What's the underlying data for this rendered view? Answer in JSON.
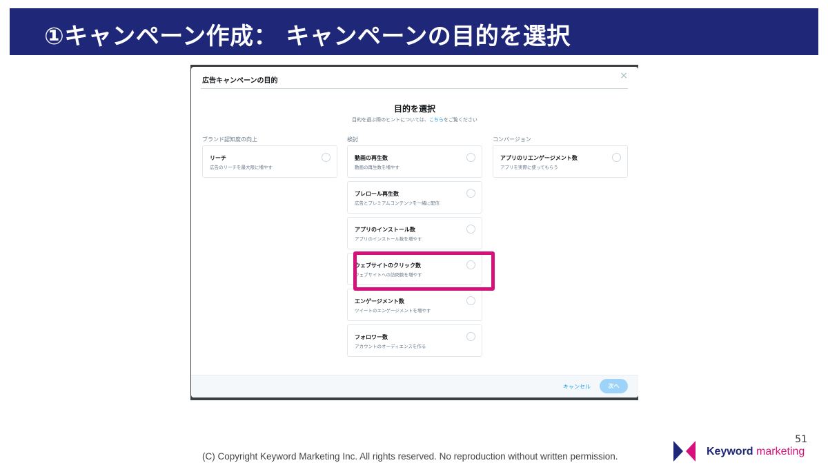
{
  "slide": {
    "title": "①キャンペーン作成： キャンペーンの目的を選択",
    "page_number": "51",
    "copyright": "(C) Copyright Keyword Marketing Inc. All rights reserved. No reproduction without written permission.",
    "logo": {
      "word1": "Keyword",
      "word2": "marketing"
    },
    "colors": {
      "banner": "#1f2878",
      "highlight": "#d6117b",
      "link": "#1da1f2"
    }
  },
  "dialog": {
    "title": "広告キャンペーンの目的",
    "close_icon": "close-icon",
    "heading": "目的を選択",
    "hint_prefix": "目的を選ぶ際のヒントについては、",
    "hint_link": "こちら",
    "hint_suffix": "をご覧ください",
    "columns": [
      {
        "label": "ブランド認知度の向上",
        "cards": [
          {
            "title": "リーチ",
            "desc": "広告のリーチを最大限に増やす"
          }
        ]
      },
      {
        "label": "検討",
        "cards": [
          {
            "title": "動画の再生数",
            "desc": "動画の再生数を増やす"
          },
          {
            "title": "プレロール再生数",
            "desc": "広告とプレミアムコンテンツを一緒に配信"
          },
          {
            "title": "アプリのインストール数",
            "desc": "アプリのインストール数を増やす"
          },
          {
            "title": "ウェブサイトのクリック数",
            "desc": "ウェブサイトへの訪問数を増やす"
          },
          {
            "title": "エンゲージメント数",
            "desc": "ツイートのエンゲージメントを増やす"
          },
          {
            "title": "フォロワー数",
            "desc": "アカウントのオーディエンスを作る"
          }
        ]
      },
      {
        "label": "コンバージョン",
        "cards": [
          {
            "title": "アプリのリエンゲージメント数",
            "desc": "アプリを実際に使ってもらう"
          }
        ]
      }
    ],
    "footer": {
      "cancel_label": "キャンセル",
      "next_label": "次へ"
    }
  }
}
